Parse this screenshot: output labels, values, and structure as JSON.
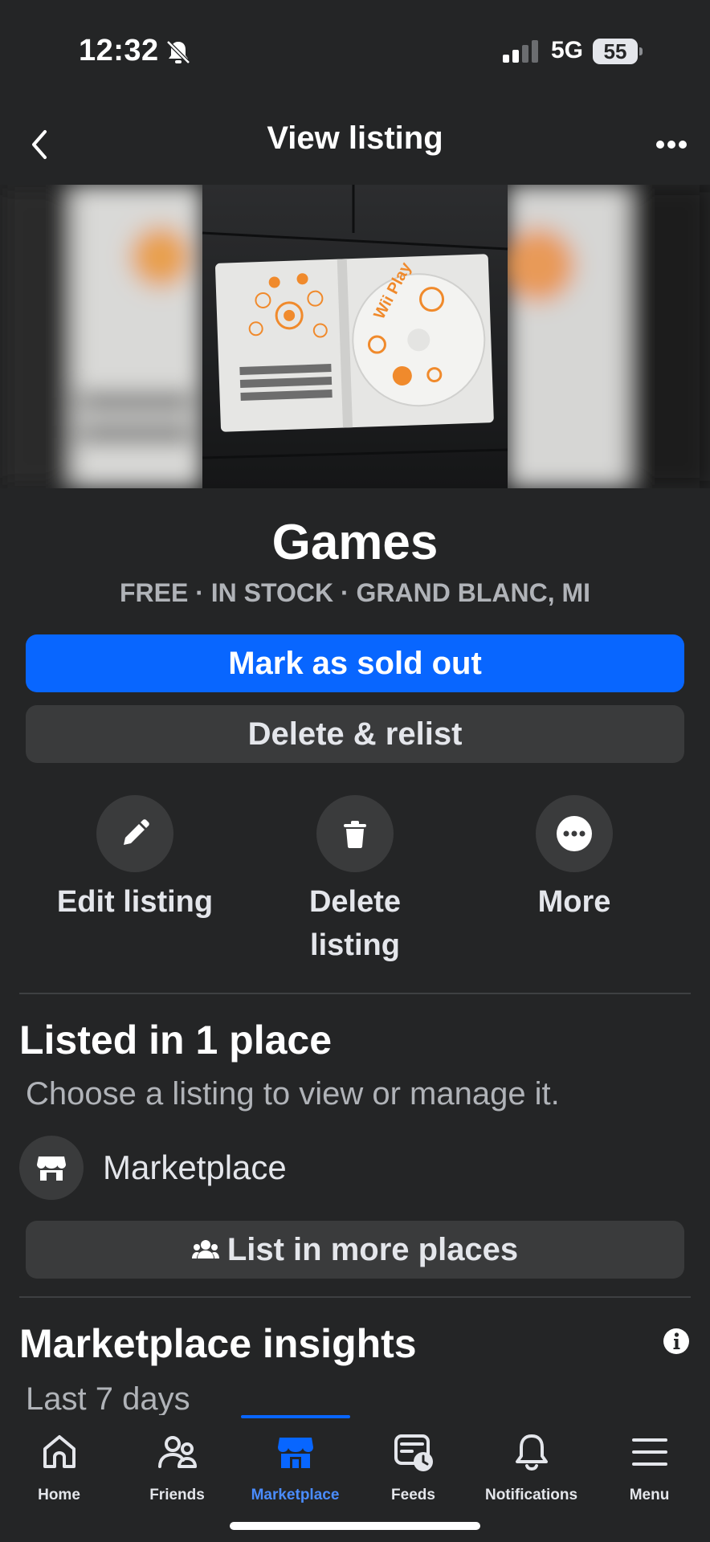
{
  "status_bar": {
    "time": "12:32",
    "network": "5G",
    "battery": "55"
  },
  "header": {
    "title": "View listing"
  },
  "listing": {
    "title": "Games",
    "meta": "FREE · IN STOCK · GRAND BLANC, MI",
    "photo_text": {
      "disc_label": "Wii Play",
      "line1": "REGISTER YOUR SOFTWARE",
      "line2": "ENREGISTREZ VOTRE JEU",
      "line3": "REGISTRA TUS JUEGOS"
    }
  },
  "buttons": {
    "mark_sold": "Mark as sold out",
    "delete_relist": "Delete & relist"
  },
  "actions": {
    "edit": "Edit listing",
    "delete_line1": "Delete",
    "delete_line2": "listing",
    "more": "More"
  },
  "listed": {
    "title": "Listed in 1 place",
    "subtitle": "Choose a listing to view or manage it.",
    "place": "Marketplace",
    "list_more": "List in more places"
  },
  "insights": {
    "title": "Marketplace insights",
    "subtitle": "Last 7 days"
  },
  "tabs": [
    {
      "label": "Home",
      "icon": "home-icon"
    },
    {
      "label": "Friends",
      "icon": "friends-icon"
    },
    {
      "label": "Marketplace",
      "icon": "marketplace-icon",
      "active": true
    },
    {
      "label": "Feeds",
      "icon": "feeds-icon"
    },
    {
      "label": "Notifications",
      "icon": "bell-icon"
    },
    {
      "label": "Menu",
      "icon": "menu-icon"
    }
  ],
  "colors": {
    "accent": "#0866ff",
    "background": "#242526",
    "surface": "#3a3b3c",
    "active_tab": "#4a8cff"
  }
}
